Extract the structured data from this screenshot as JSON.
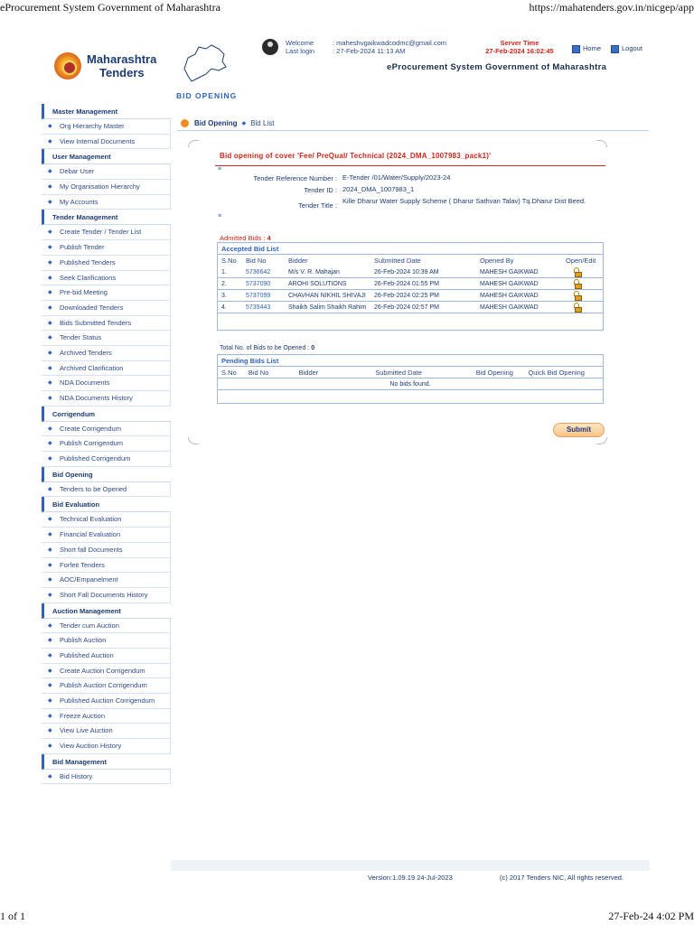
{
  "print": {
    "header_left": "eProcurement System Government of Maharashtra",
    "header_right": "https://mahatenders.gov.in/nicgep/app",
    "footer_left": "1 of 1",
    "footer_right": "27-Feb-24 4:02 PM"
  },
  "brand": {
    "line1": "Maharashtra",
    "line2": "Tenders",
    "site_title": "eProcurement System Government of Maharashtra"
  },
  "user": {
    "welcome_label": "Welcome",
    "welcome_value": ": maheshvgaikwadcodmc@gmail.com",
    "lastlogin_label": "Last login",
    "lastlogin_value": ": 27-Feb-2024 11:13 AM"
  },
  "server": {
    "label": "Server Time",
    "value": "27-Feb-2024 16:02:45"
  },
  "nav": {
    "home": "Home",
    "logout": "Logout"
  },
  "page_heading": "BID OPENING",
  "sidebar": [
    {
      "title": "Master Management",
      "items": [
        "Org Hierarchy Master",
        "View Internal Documents"
      ]
    },
    {
      "title": "User Management",
      "items": [
        "Debar User",
        "My Organisation Hierarchy",
        "My Accounts"
      ]
    },
    {
      "title": "Tender Management",
      "items": [
        "Create Tender / Tender List",
        "Publish Tender",
        "Published Tenders",
        "Seek Clarifications",
        "Pre-bid Meeting",
        "Downloaded Tenders",
        "Bids Submitted Tenders",
        "Tender Status",
        "Archived Tenders",
        "Archived Clarification",
        "NDA Documents",
        "NDA Documents History"
      ]
    },
    {
      "title": "Corrigendum",
      "items": [
        "Create Corrigendum",
        "Publish Corrigendum",
        "Published Corrigendum"
      ]
    },
    {
      "title": "Bid Opening",
      "items": [
        "Tenders to be Opened"
      ]
    },
    {
      "title": "Bid Evaluation",
      "items": [
        "Technical Evaluation",
        "Financial Evaluation",
        "Short fall Documents",
        "Forfeit Tenders",
        "AOC/Empanelment",
        "Short Fall Documents History"
      ]
    },
    {
      "title": "Auction Management",
      "items": [
        "Tender cum Auction",
        "Publish Auction",
        "Published Auction",
        "Create Auction Corrigendum",
        "Publish Auction Corrigendum",
        "Published Auction Corrigendum",
        "Freeze Auction",
        "View Live Auction",
        "View Auction History"
      ]
    },
    {
      "title": "Bid Management",
      "items": [
        "Bid History"
      ]
    }
  ],
  "breadcrumb": {
    "active": "Bid Opening",
    "link": "Bid List"
  },
  "cover_title": "Bid opening of cover 'Fee/ PreQual/ Technical (2024_DMA_1007983_pack1)'",
  "tender": {
    "ref_label": "Tender Reference Number :",
    "ref_value": "E-Tender /01/Water/Supply/2023-24",
    "id_label": "Tender ID :",
    "id_value": "2024_DMA_1007983_1",
    "title_label": "Tender Title :",
    "title_value": "Kille Dharur Water Supply Scheme ( Dharur Sathvan Talav) Tq.Dharur Dist Beed."
  },
  "admitted": {
    "label": "Admitted Bids :",
    "value": "4"
  },
  "accepted": {
    "title": "Accepted Bid List",
    "headers": [
      "S.No",
      "Bid No",
      "Bidder",
      "Submitted Date",
      "Opened By",
      "Open/Edit"
    ],
    "rows": [
      {
        "sno": "1.",
        "bid": "5736642",
        "bidder": "M/s V. R. Mahajan",
        "date": "26-Feb-2024 10:39 AM",
        "by": "MAHESH GAIKWAD"
      },
      {
        "sno": "2.",
        "bid": "5737090",
        "bidder": "AROHI SOLUTIONS",
        "date": "26-Feb-2024 01:55 PM",
        "by": "MAHESH GAIKWAD"
      },
      {
        "sno": "3.",
        "bid": "5737099",
        "bidder": "CHAVHAN NIKHIL SHIVAJI",
        "date": "26-Feb-2024 02:25 PM",
        "by": "MAHESH GAIKWAD"
      },
      {
        "sno": "4.",
        "bid": "5739443",
        "bidder": "Shaikh Salim Shaikh Rahim",
        "date": "26-Feb-2024 02:57 PM",
        "by": "MAHESH GAIKWAD"
      }
    ]
  },
  "to_open": {
    "label": "Total No. of Bids to be Opened :",
    "value": "0"
  },
  "pending": {
    "title": "Pending Bids List",
    "headers": [
      "S.No",
      "Bid No",
      "Bidder",
      "Submitted Date",
      "Bid Opening",
      "Quick Bid Opening"
    ],
    "empty": "No bids found."
  },
  "submit_label": "Submit",
  "footer": {
    "version": "Version:1.09.19 24-Jul-2023",
    "copy": "(c) 2017 Tenders NIC, All rights reserved."
  }
}
